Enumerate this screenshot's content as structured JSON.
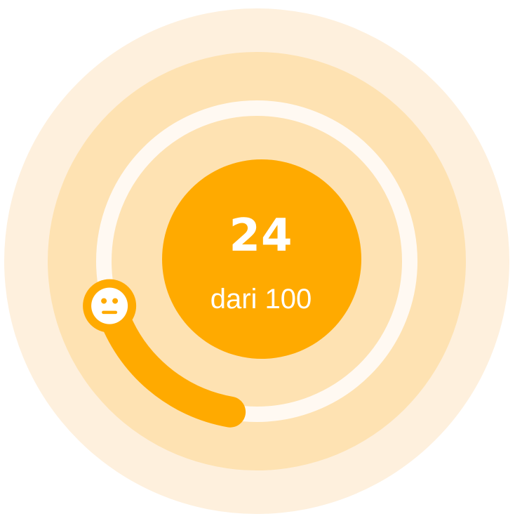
{
  "score": {
    "value": "24",
    "caption": "dari 100",
    "fraction": 0.24
  },
  "mood_icon": "neutral-face-icon",
  "colors": {
    "accent": "#FFAA00",
    "halo_outer": "#FEF0DD",
    "halo_inner": "#FEE2B2",
    "track": "#FFF9F2",
    "text": "#FFFFFF"
  }
}
